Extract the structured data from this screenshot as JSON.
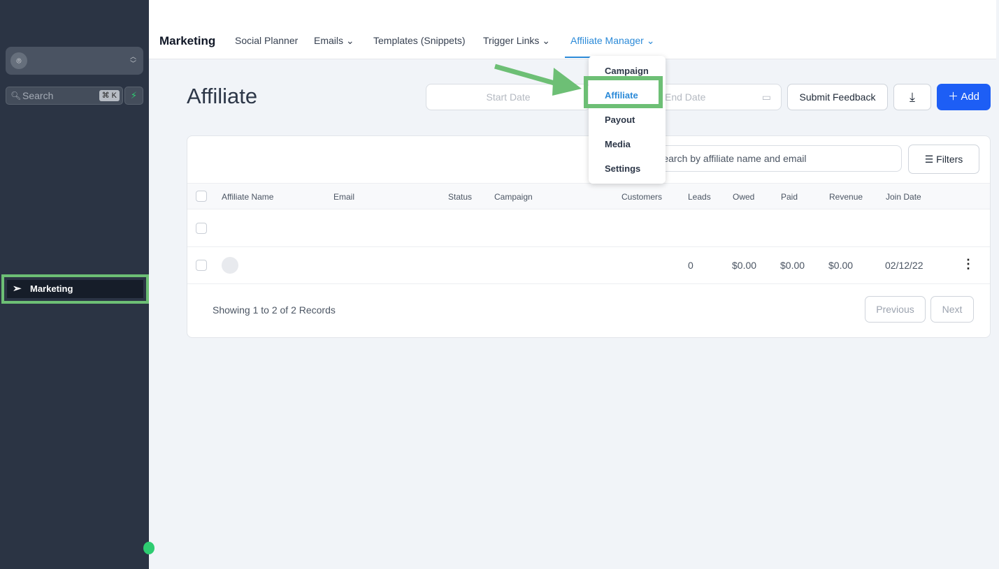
{
  "sidebar": {
    "search_placeholder": "Search",
    "search_shortcut": "⌘ K",
    "active_item": "Marketing"
  },
  "topnav": {
    "brand": "Marketing",
    "items": [
      "Social Planner",
      "Emails",
      "Templates (Snippets)",
      "Trigger Links",
      "Affiliate Manager"
    ],
    "active": "Affiliate Manager"
  },
  "dropdown": {
    "items": [
      "Campaign",
      "Affiliate",
      "Payout",
      "Media",
      "Settings"
    ],
    "selected": "Affiliate"
  },
  "page": {
    "title": "Affiliate",
    "start_date_placeholder": "Start Date",
    "end_date_placeholder": "End Date",
    "submit_feedback": "Submit Feedback",
    "add": "Add"
  },
  "table": {
    "search_placeholder": "Search by affiliate name and email",
    "filters": "Filters",
    "columns": [
      "Affiliate Name",
      "Email",
      "Status",
      "Campaign",
      "Customers",
      "Leads",
      "Owed",
      "Paid",
      "Revenue",
      "Join Date"
    ],
    "rows": [
      {
        "leads": "",
        "owed": "",
        "paid": "",
        "revenue": "",
        "join_date": ""
      },
      {
        "leads": "0",
        "owed": "$0.00",
        "paid": "$0.00",
        "revenue": "$0.00",
        "join_date": "02/12/22"
      }
    ],
    "footer": "Showing 1 to 2 of 2 Records",
    "previous": "Previous",
    "next": "Next"
  },
  "colors": {
    "accent": "#1d5ef5",
    "active_tab": "#2b8ad8",
    "highlight": "#6dbf75",
    "sidebar": "#2b3444"
  }
}
